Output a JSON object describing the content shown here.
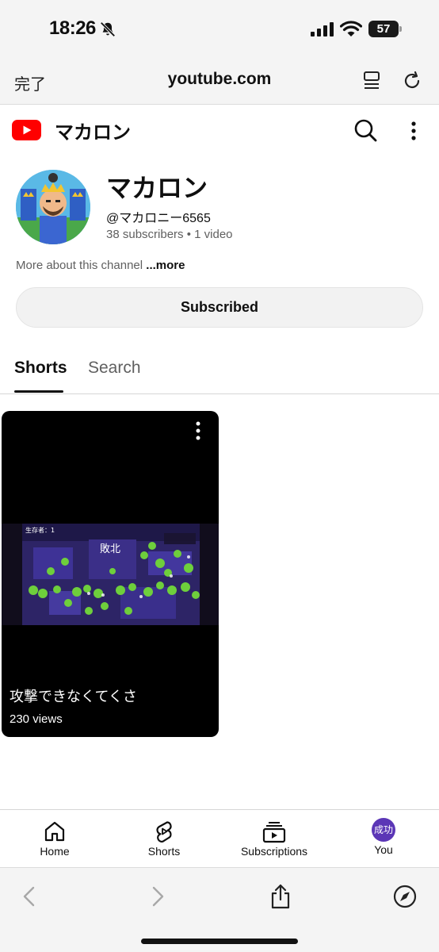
{
  "status_bar": {
    "time": "18:26",
    "battery": "57"
  },
  "safari": {
    "done_label": "完了",
    "url": "youtube.com"
  },
  "header": {
    "title": "マカロン"
  },
  "channel": {
    "name": "マカロン",
    "handle": "@マカロニー6565",
    "subscribers": "38 subscribers",
    "separator": "•",
    "videos": "1 video",
    "about": "More about this channel",
    "more": "...more",
    "subscribe_label": "Subscribed"
  },
  "tabs": [
    {
      "label": "Shorts",
      "selected": true
    },
    {
      "label": "Search",
      "selected": false
    }
  ],
  "shorts": [
    {
      "title": "攻撃できなくてくさ",
      "views": "230 views",
      "thumb_texts": {
        "survivors": "生存者：1",
        "defeat": "敗北"
      }
    }
  ],
  "bottom_nav": [
    {
      "label": "Home",
      "icon": "home-icon"
    },
    {
      "label": "Shorts",
      "icon": "shorts-icon"
    },
    {
      "label": "Subscriptions",
      "icon": "subscriptions-icon"
    },
    {
      "label": "You",
      "icon": "avatar",
      "avatar_text": "成功"
    }
  ],
  "colors": {
    "youtube_red": "#ff0000",
    "you_avatar": "#5b36b6",
    "thumb_green": "#6ecf3c",
    "thumb_purple": "#3a2a8a"
  }
}
